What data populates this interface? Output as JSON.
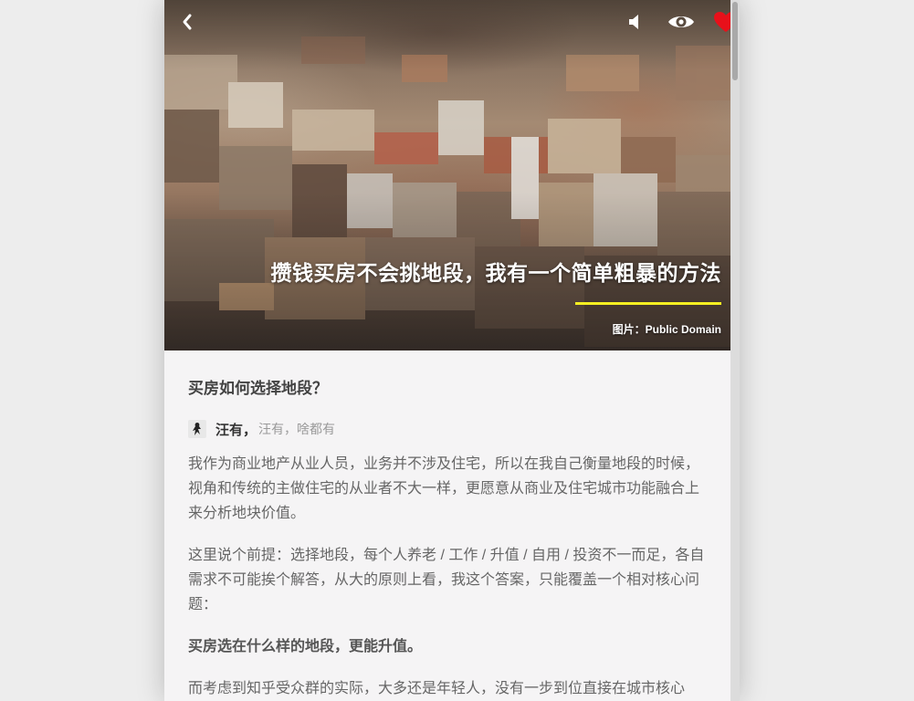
{
  "colors": {
    "heart": "#e8101a",
    "title_rule": "#f7f022",
    "background": "#ededed",
    "content_bg": "#f5f4f5"
  },
  "header": {
    "icons": [
      "back-icon",
      "volume-icon",
      "eye-icon",
      "heart-icon"
    ]
  },
  "hero": {
    "title": "攒钱买房不会挑地段，我有一个简单粗暴的方法",
    "image_credit": "图片：Public Domain"
  },
  "article": {
    "question": "买房如何选择地段？",
    "author": {
      "name": "汪有，",
      "bio": "汪有，啥都有"
    },
    "paragraphs": [
      "我作为商业地产从业人员，业务并不涉及住宅，所以在我自己衡量地段的时候，视角和传统的主做住宅的从业者不大一样，更愿意从商业及住宅城市功能融合上来分析地块价值。",
      "这里说个前提：选择地段，每个人养老 / 工作 / 升值 / 自用 / 投资不一而足，各自需求不可能挨个解答，从大的原则上看，我这个答案，只能覆盖一个相对核心问题："
    ],
    "bold_statement": "买房选在什么样的地段，更能升值。",
    "trailing_paragraph": "而考虑到知乎受众群的实际，大多还是年轻人，没有一步到位直接在城市核心"
  }
}
